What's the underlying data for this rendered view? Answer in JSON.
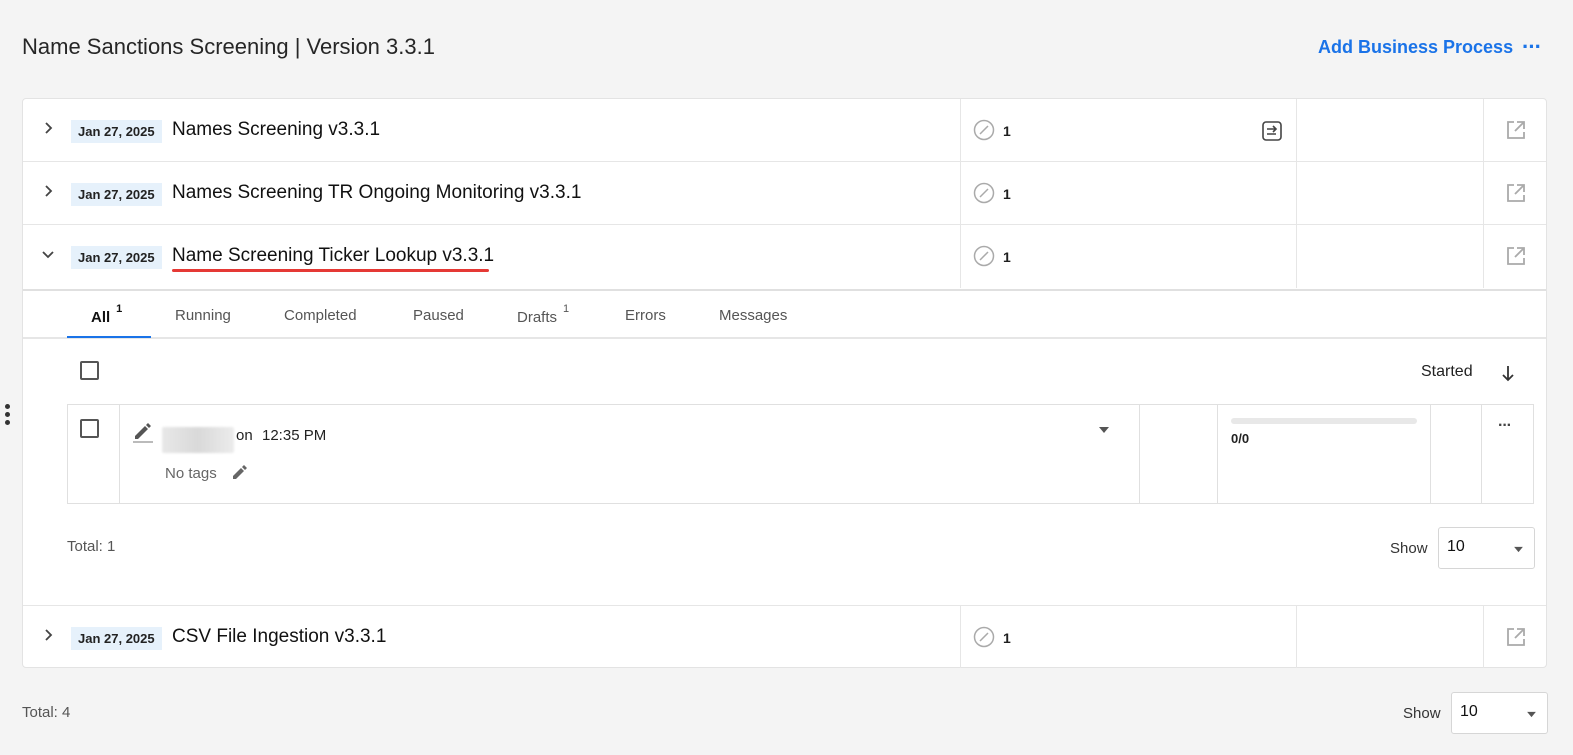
{
  "header": {
    "title": "Name Sanctions Screening | Version 3.3.1",
    "add_button": "Add Business Process",
    "more": "···"
  },
  "processes": [
    {
      "date": "Jan 27, 2025",
      "name": "Names Screening v3.3.1",
      "count": "1",
      "expanded": false,
      "has_flow_icon": true
    },
    {
      "date": "Jan 27, 2025",
      "name": "Names Screening TR Ongoing Monitoring v3.3.1",
      "count": "1",
      "expanded": false,
      "has_flow_icon": false
    },
    {
      "date": "Jan 27, 2025",
      "name": "Name Screening Ticker Lookup v3.3.1",
      "count": "1",
      "expanded": true,
      "has_flow_icon": false
    },
    {
      "date": "Jan 27, 2025",
      "name": "CSV File Ingestion v3.3.1",
      "count": "1",
      "expanded": false,
      "has_flow_icon": false
    }
  ],
  "tabs": [
    {
      "label": "All",
      "badge": "1",
      "active": true
    },
    {
      "label": "Running",
      "badge": ""
    },
    {
      "label": "Completed",
      "badge": ""
    },
    {
      "label": "Paused",
      "badge": ""
    },
    {
      "label": "Drafts",
      "badge": "1"
    },
    {
      "label": "Errors",
      "badge": ""
    },
    {
      "label": "Messages",
      "badge": ""
    }
  ],
  "list": {
    "sort_label": "Started",
    "instance": {
      "on_label": "on",
      "time": "12:35 PM",
      "tags": "No tags",
      "progress_text": "0/0",
      "progress_fraction": 0,
      "more": "···"
    },
    "total": "Total: 1",
    "show_label": "Show",
    "page_size": "10"
  },
  "footer": {
    "total": "Total: 4",
    "show_label": "Show",
    "page_size": "10"
  },
  "colors": {
    "accent": "#1a73e8",
    "date_badge_bg": "#e6f1fb",
    "highlight_underline": "#e53935"
  }
}
